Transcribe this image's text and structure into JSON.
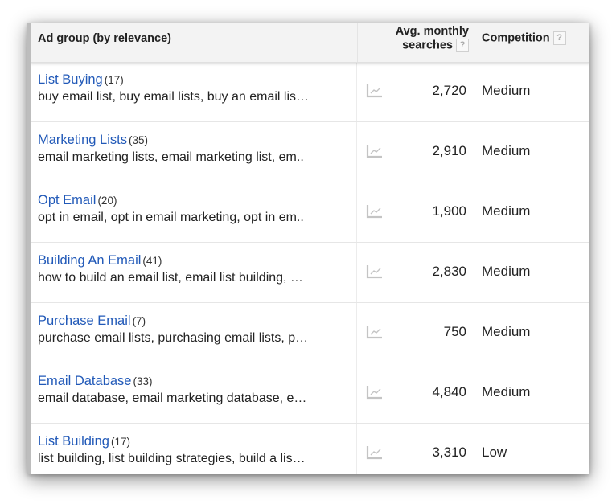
{
  "table": {
    "headers": {
      "ad_group": "Ad group (by relevance)",
      "searches_line1": "Avg. monthly",
      "searches_line2": "searches",
      "competition": "Competition",
      "help_glyph": "?"
    },
    "trend_icon": "line-chart-icon",
    "rows": [
      {
        "name": "List Buying",
        "count": "(17)",
        "keywords": "buy email list, buy email lists, buy an email lis…",
        "searches": "2,720",
        "competition": "Medium"
      },
      {
        "name": "Marketing Lists",
        "count": "(35)",
        "keywords": "email marketing lists, email marketing list, em..",
        "searches": "2,910",
        "competition": "Medium"
      },
      {
        "name": "Opt Email",
        "count": "(20)",
        "keywords": "opt in email, opt in email marketing, opt in em..",
        "searches": "1,900",
        "competition": "Medium"
      },
      {
        "name": "Building An Email",
        "count": "(41)",
        "keywords": "how to build an email list, email list building, …",
        "searches": "2,830",
        "competition": "Medium"
      },
      {
        "name": "Purchase Email",
        "count": "(7)",
        "keywords": "purchase email lists, purchasing email lists, p…",
        "searches": "750",
        "competition": "Medium"
      },
      {
        "name": "Email Database",
        "count": "(33)",
        "keywords": "email database, email marketing database, e…",
        "searches": "4,840",
        "competition": "Medium"
      },
      {
        "name": "List Building",
        "count": "(17)",
        "keywords": "list building, list building strategies, build a lis…",
        "searches": "3,310",
        "competition": "Low"
      }
    ]
  },
  "colors": {
    "link": "#2159b8",
    "header_bg": "#f3f3f3",
    "trend_icon": "#c4c4c4"
  }
}
